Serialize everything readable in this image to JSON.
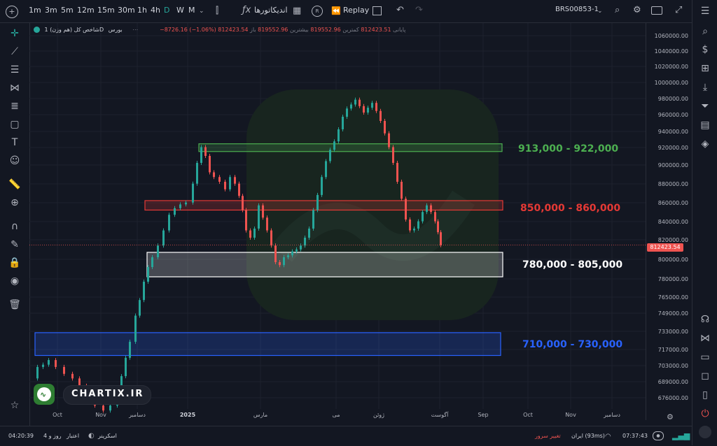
{
  "toolbar": {
    "intervals": [
      "1m",
      "3m",
      "5m",
      "12m",
      "15m",
      "30m",
      "1h",
      "4h",
      "D",
      "W",
      "M"
    ],
    "active_interval": "D",
    "indicators_label": "اندیکاتورها",
    "r_badge": "R",
    "replay_label": "Replay",
    "symbol": "BRS00853-1"
  },
  "legend": {
    "title": "شاخص کل (هم وزن)",
    "interval": "1D",
    "exchange": "بورس",
    "open_label": "باز",
    "open_value": "819552.96",
    "high_label": "بیشترین",
    "high_value": "819552.96",
    "low_label": "کمترین",
    "low_value": "812423.51",
    "close_label": "پایانی",
    "close_value": "812423.54",
    "change": "−8726.16 (−1.06%)"
  },
  "y_axis": {
    "labels": [
      "1060000.00",
      "1040000.00",
      "1020000.00",
      "1000000.00",
      "980000.00",
      "960000.00",
      "940000.00",
      "920000.00",
      "900000.00",
      "880000.00",
      "860000.00",
      "840000.00",
      "820000.00",
      "800000.00",
      "780000.00",
      "765000.00",
      "749000.00",
      "733000.00",
      "717000.00",
      "703000.00",
      "689000.00",
      "676000.00"
    ],
    "last_price": "812423.54"
  },
  "x_axis": {
    "labels": [
      "Oct",
      "Nov",
      "دسامبر",
      "2025",
      "مارس",
      "می",
      "ژوئن",
      "آگوست",
      "Sep",
      "Oct",
      "Nov",
      "دسامبر"
    ],
    "bold_label": "2025"
  },
  "zones": [
    {
      "label": "913,000 - 922,000",
      "low": 913000,
      "high": 922000,
      "color": "#4caf50"
    },
    {
      "label": "850,000 - 860,000",
      "low": 850000,
      "high": 860000,
      "color": "#e53935"
    },
    {
      "label": "780,000 - 805,000",
      "low": 780000,
      "high": 805000,
      "color": "#ffffff"
    },
    {
      "label": "710,000 - 730,000",
      "low": 710000,
      "high": 730000,
      "color": "#2962ff"
    }
  ],
  "watermark": {
    "brand": "CHARTIX.IR"
  },
  "status": {
    "datetime": "04:20:39",
    "credit_days": "4 روز و",
    "credit_label": "اعتبار",
    "screener": "اسکرینر",
    "server_change": "تغییر سرور",
    "server": "ایران (93ms)",
    "clock": "07:37:43"
  },
  "colors": {
    "up": "#26a69a",
    "down": "#ef5350",
    "background": "#131722",
    "accent": "#26a69a"
  }
}
